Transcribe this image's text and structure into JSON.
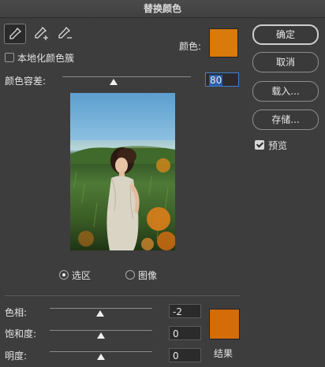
{
  "window": {
    "title": "替换颜色"
  },
  "tools": [
    {
      "name": "eyedropper-icon"
    },
    {
      "name": "eyedropper-plus-icon"
    },
    {
      "name": "eyedropper-minus-icon"
    }
  ],
  "selection": {
    "localized_clusters_label": "本地化颜色簇",
    "localized_clusters_checked": false,
    "color_label": "颜色:",
    "color_hex": "#d97a0b",
    "fuzziness_label": "颜色容差:",
    "fuzziness_value": "80",
    "fuzziness_level_fraction": 0.4
  },
  "buttons": {
    "ok": "确定",
    "cancel": "取消",
    "load": "载入...",
    "save": "存储..."
  },
  "preview_option": {
    "label": "预览",
    "checked": true
  },
  "view_mode": {
    "selection_label": "选区",
    "image_label": "图像",
    "selected": "selection"
  },
  "replacement": {
    "hue_label": "色相:",
    "hue_value": "-2",
    "hue_level_fraction": 0.49,
    "saturation_label": "饱和度:",
    "saturation_value": "0",
    "saturation_level_fraction": 0.5,
    "lightness_label": "明度:",
    "lightness_value": "0",
    "lightness_level_fraction": 0.5,
    "result_label": "结果",
    "result_hex": "#d46c08"
  }
}
